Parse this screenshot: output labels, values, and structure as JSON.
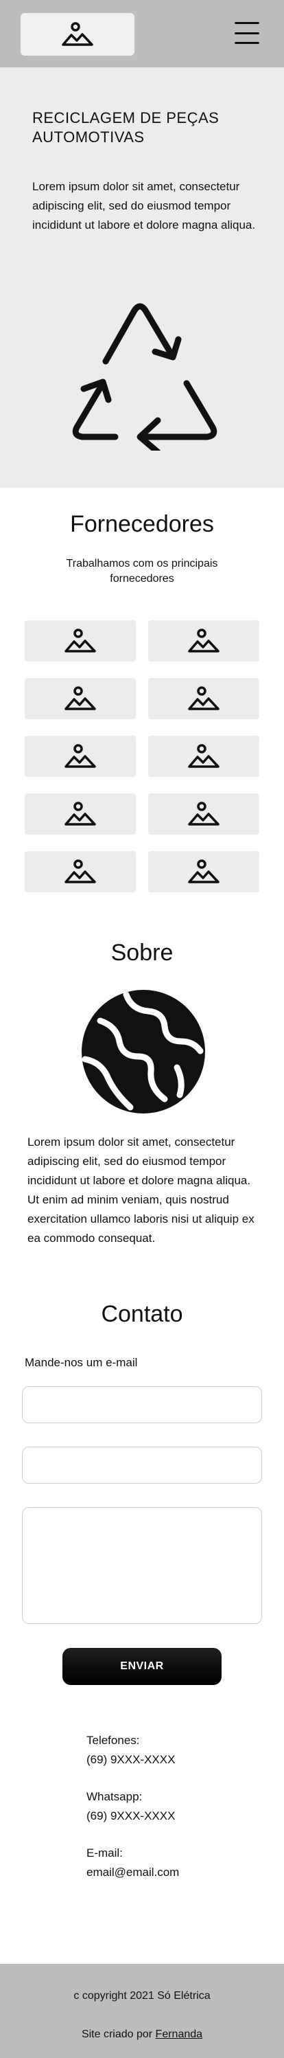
{
  "header": {
    "logo_icon": "image-placeholder-icon",
    "menu_icon": "hamburger-menu-icon"
  },
  "hero": {
    "title": "RECICLAGEM DE PEÇAS AUTOMOTIVAS",
    "text": "Lorem ipsum dolor sit amet, consectetur adipiscing elit, sed do eiusmod tempor incididunt ut labore et dolore magna aliqua.",
    "icon": "recycle-icon"
  },
  "suppliers": {
    "title": "Fornecedores",
    "subtitle": "Trabalhamos com os principais fornecedores",
    "logo_count_note": "10 placeholder supplier logos",
    "logo_icon": "image-placeholder-icon"
  },
  "about": {
    "title": "Sobre",
    "icon": "globe-icon",
    "text": "Lorem ipsum dolor sit amet, consectetur adipiscing elit, sed do eiusmod tempor incididunt ut labore et dolore magna aliqua. Ut enim ad minim veniam, quis nostrud exercitation ullamco laboris nisi ut aliquip ex ea commodo consequat."
  },
  "contact": {
    "title": "Contato",
    "label": "Mande-nos um e-mail",
    "name_value": "",
    "email_value": "",
    "message_value": "",
    "send_label": "ENVIAR",
    "phones_label": "Telefones:",
    "phones_value": "(69) 9XXX-XXXX",
    "whatsapp_label": "Whatsapp:",
    "whatsapp_value": "(69) 9XXX-XXXX",
    "email_label": "E-mail:",
    "email_address": "email@email.com"
  },
  "footer": {
    "copyright": "c copyright 2021 Só Elétrica",
    "credit_prefix": "Site criado por ",
    "credit_name": "Fernanda"
  },
  "colors": {
    "header_bg": "#bdbdbd",
    "section_bg": "#ececec",
    "button_bg": "#000000"
  }
}
